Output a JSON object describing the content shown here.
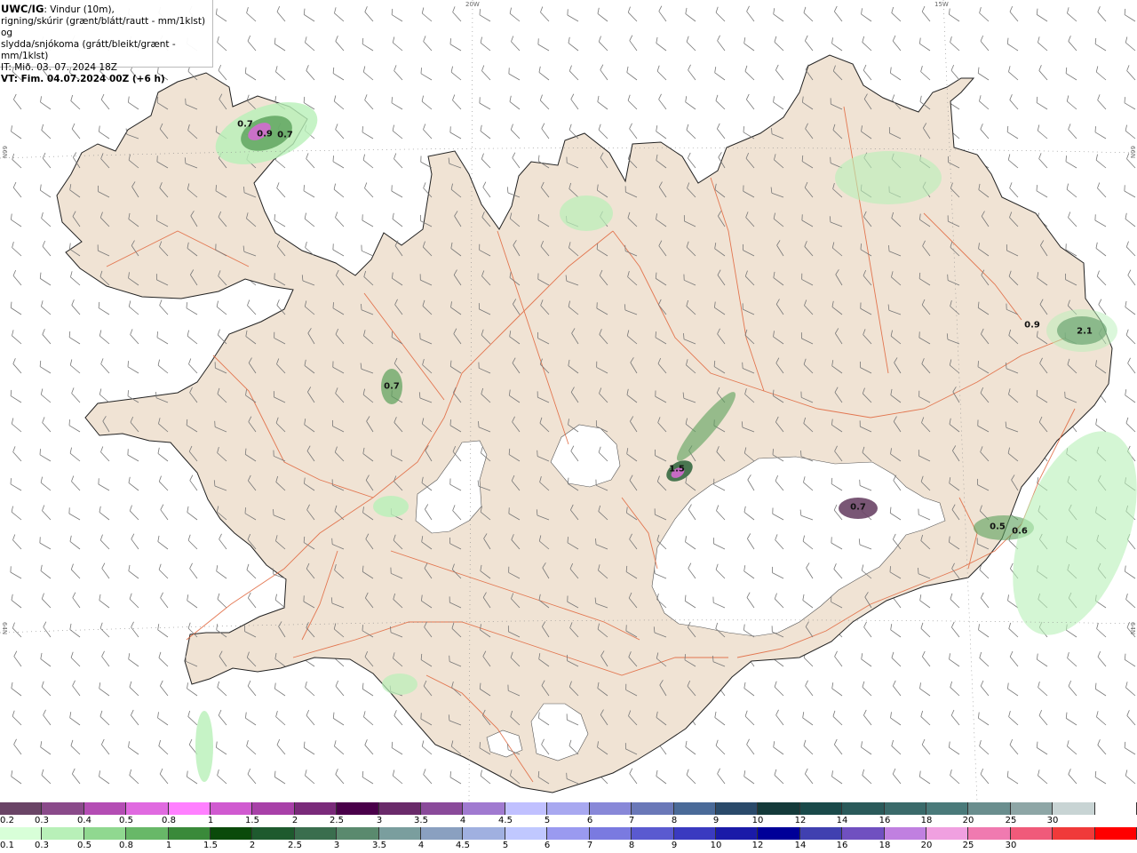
{
  "header": {
    "brand": "UWC/IG",
    "title_line1": ": Vindur (10m),",
    "title_line2": "rigning/skúrir (grænt/blátt/rautt - mm/1klst) og",
    "title_line3": "slydda/snjókoma (grátt/bleikt/grænt - mm/1klst)",
    "it_line": "IT: Mið. 03. 07. 2024 18Z",
    "vt_line": "VT: Fim. 04.07.2024 00Z (+6 h)"
  },
  "map": {
    "land_color": "#f0e3d4",
    "sea_color": "#ffffff",
    "glacier_color": "#ffffff",
    "road_color": "#e0643a",
    "barb_color": "#777777",
    "precip_light": "#b8f0b8",
    "precip_mid": "#5aa05a",
    "precip_dark": "#1f5a2e",
    "snow_color": "#d46ad0",
    "coords": {
      "top_left": "20W",
      "top_right": "15W",
      "left_upper": "66N",
      "left_lower": "64N",
      "right_upper": "66N",
      "right_lower": "64N"
    },
    "value_labels": [
      "0.7",
      "0.9",
      "0.7",
      "0.7",
      "1.5",
      "0.7",
      "0.9",
      "2.1",
      "0.5",
      "0.6"
    ]
  },
  "legend_snow": {
    "colors": [
      "#6a4466",
      "#8a4a8a",
      "#b44db4",
      "#e06ae0",
      "#ff80ff",
      "#d05ad0",
      "#a840a8",
      "#7a2a7a",
      "#4a004a",
      "#6a2a6a",
      "#8a4a9a",
      "#a07ad0",
      "#c0c0ff",
      "#a8a8f0",
      "#8888d8",
      "#6a78b8",
      "#4a6a98",
      "#2a4a6a",
      "#143a3a",
      "#1a4a4a",
      "#2a5a5a",
      "#3a6a6a",
      "#4a7a7a",
      "#6a8e8e",
      "#8ea6a6",
      "#c8d4d4",
      "#ffffff"
    ],
    "ticks": [
      "0.2",
      "0.3",
      "0.4",
      "0.5",
      "0.8",
      "1",
      "1.5",
      "2",
      "2.5",
      "3",
      "3.5",
      "4",
      "4.5",
      "5",
      "6",
      "7",
      "8",
      "9",
      "10",
      "12",
      "14",
      "16",
      "18",
      "20",
      "25",
      "30"
    ]
  },
  "legend_rain": {
    "colors": [
      "#d8ffd8",
      "#b8f0b8",
      "#90d890",
      "#68b868",
      "#3a8a3a",
      "#0a4a0a",
      "#1e5a2e",
      "#3a6e4e",
      "#5a8a6e",
      "#7a9e9e",
      "#8aa0c0",
      "#a0b0e0",
      "#c0c8ff",
      "#9a9af0",
      "#7a7ae0",
      "#5a5ad0",
      "#3a3ac0",
      "#1a1aa8",
      "#000098",
      "#4040b0",
      "#7050c0",
      "#c080e0",
      "#f0a0e0",
      "#f07ab0",
      "#f05a7a",
      "#f03a3a",
      "#ff0000"
    ],
    "ticks": [
      "0.1",
      "0.3",
      "0.5",
      "0.8",
      "1",
      "1.5",
      "2",
      "2.5",
      "3",
      "3.5",
      "4",
      "4.5",
      "5",
      "6",
      "7",
      "8",
      "9",
      "10",
      "12",
      "14",
      "16",
      "18",
      "20",
      "25",
      "30"
    ]
  }
}
